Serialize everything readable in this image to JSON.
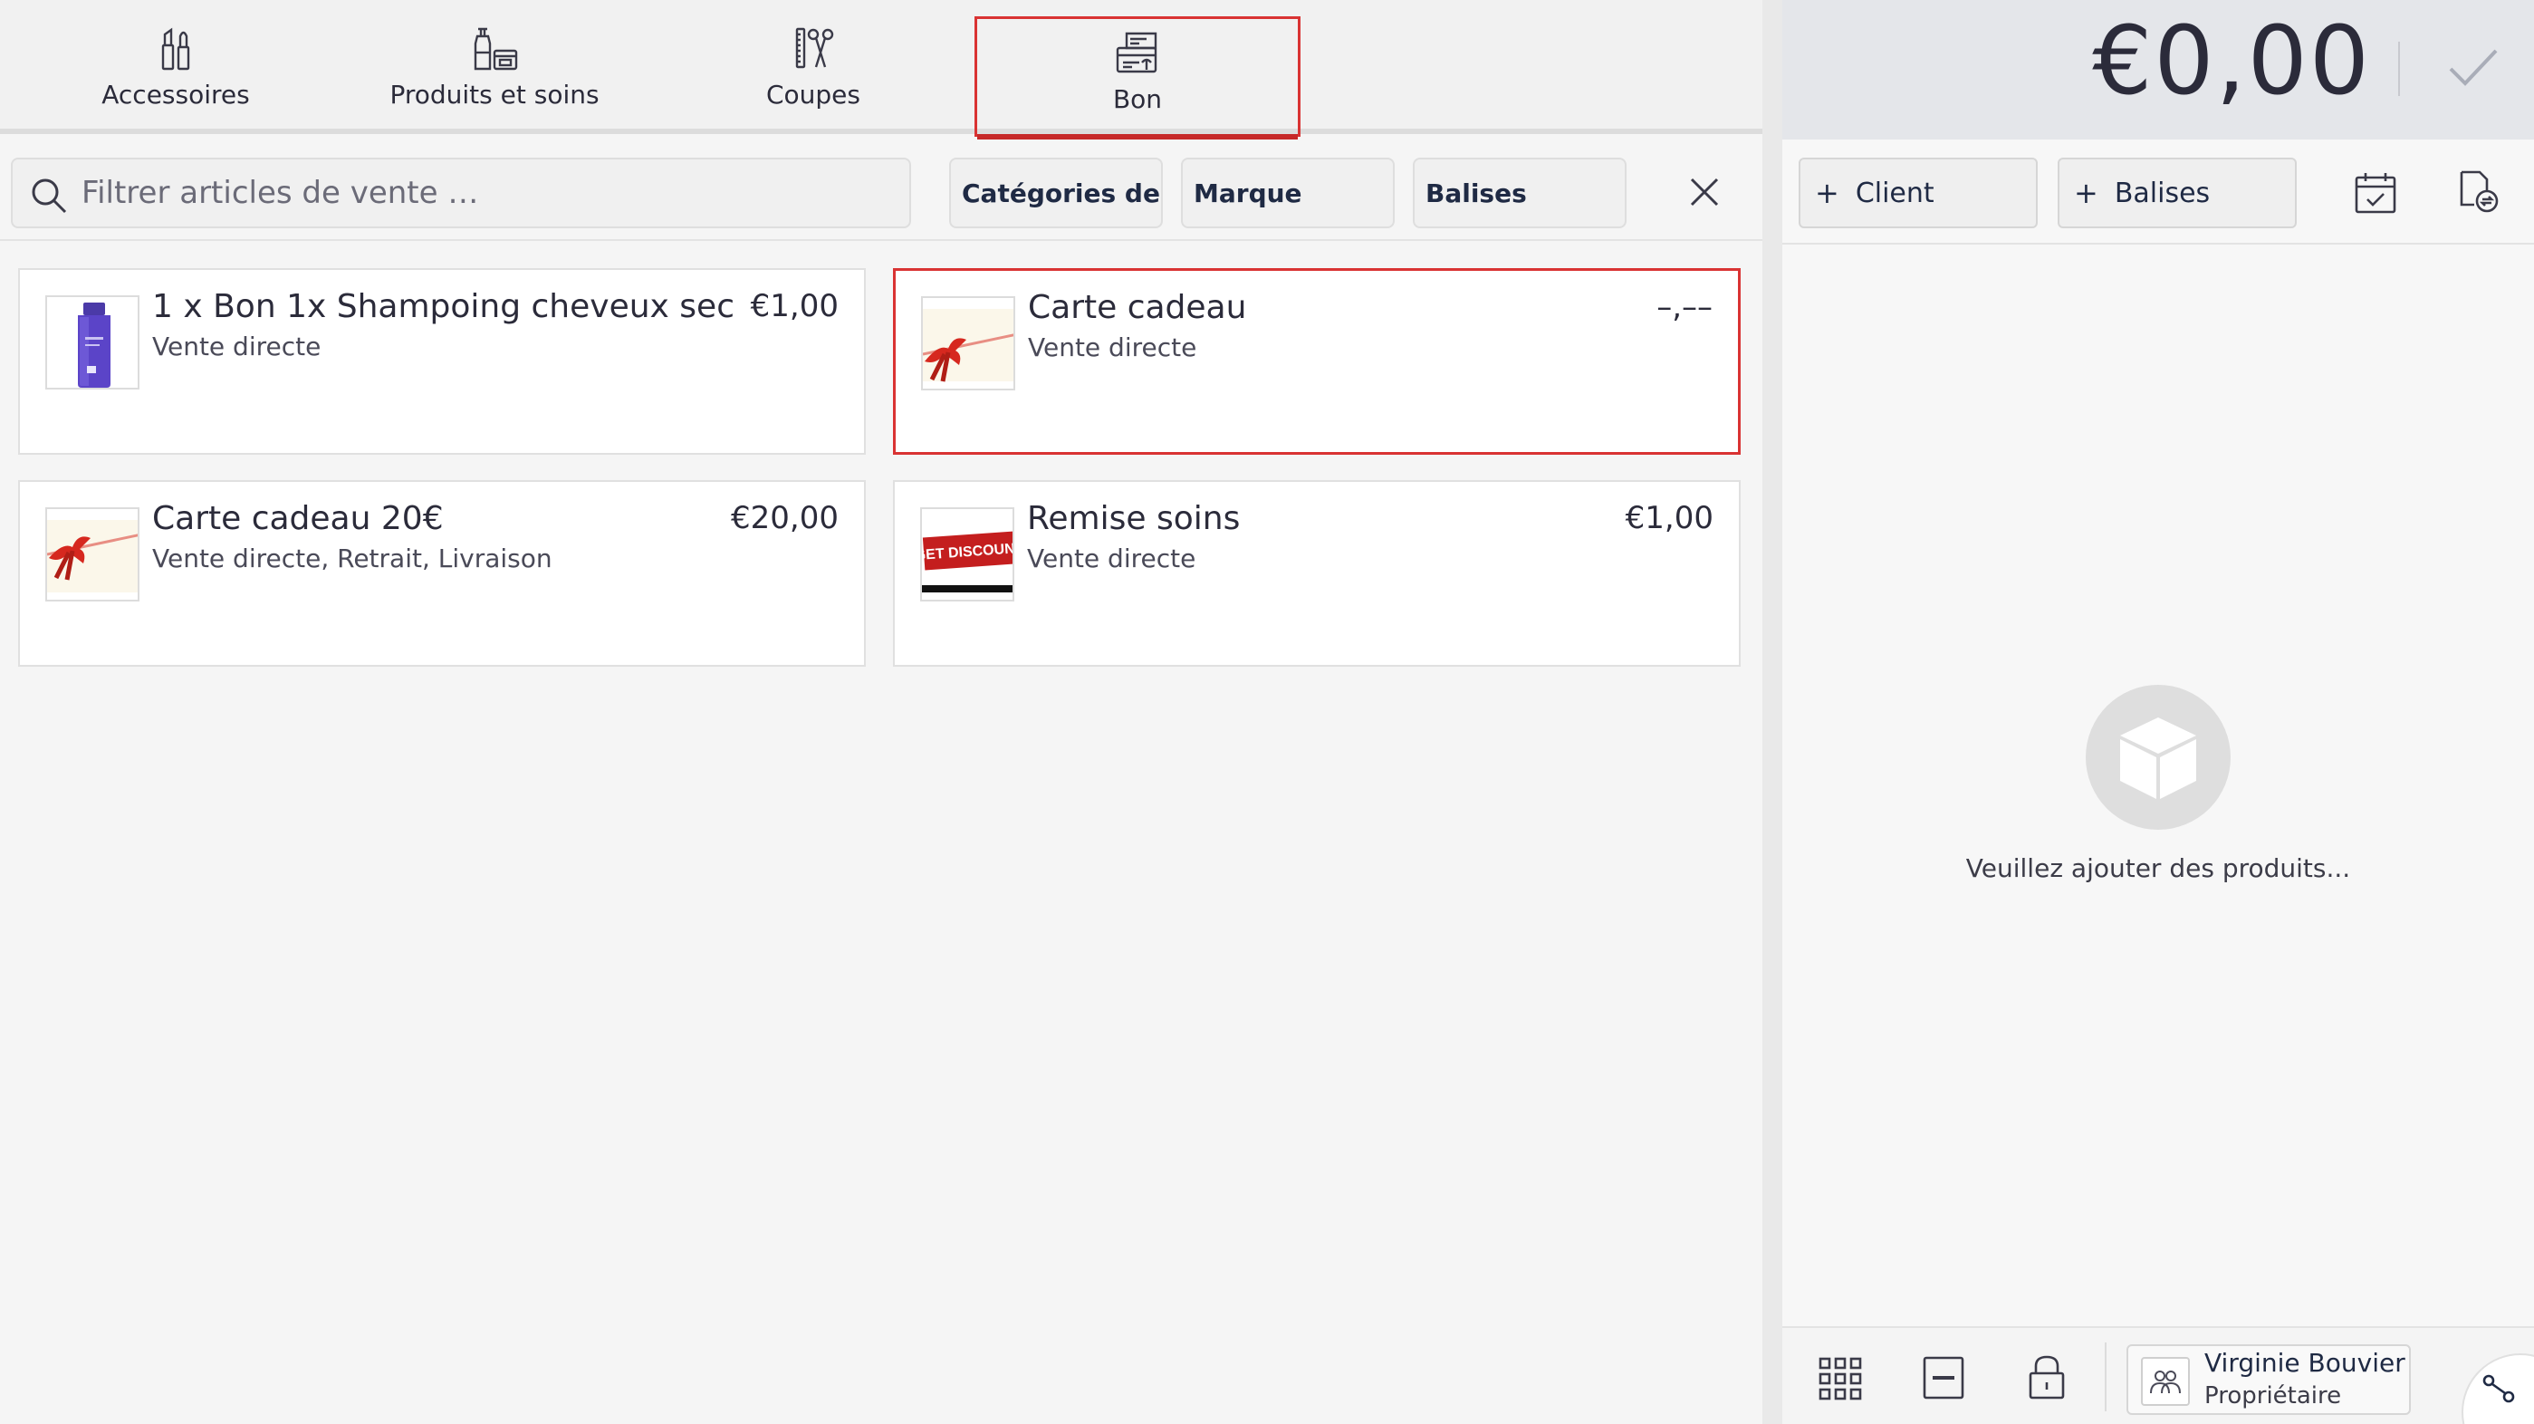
{
  "tabs": [
    {
      "label": "Accessoires",
      "icon": "lipstick-icon"
    },
    {
      "label": "Produits et soins",
      "icon": "products-bottles-icon"
    },
    {
      "label": "Coupes",
      "icon": "scissors-comb-icon"
    },
    {
      "label": "Bon",
      "icon": "voucher-icon",
      "active": true
    }
  ],
  "search": {
    "placeholder": "Filtrer articles de vente …",
    "filters": [
      "Catégories de...",
      "Marque",
      "Balises"
    ]
  },
  "products": [
    {
      "name": "1 x Bon 1x Shampoing cheveux sec",
      "subtitle": "Vente directe",
      "price": "€1,00",
      "thumb": "shampoo-bottle-image"
    },
    {
      "name": "Carte cadeau",
      "subtitle": "Vente directe",
      "price": "–,––",
      "thumb": "gift-card-bow-image",
      "selected": true
    },
    {
      "name": "Carte cadeau 20€",
      "subtitle": "Vente directe, Retrait, Livraison",
      "price": "€20,00",
      "thumb": "gift-card-bow-image"
    },
    {
      "name": "Remise soins",
      "subtitle": "Vente directe",
      "price": "€1,00",
      "thumb": "get-discount-image",
      "thumb_text": "GET DISCOUNT"
    }
  ],
  "cart": {
    "total": "€0,00",
    "client_label": "Client",
    "tags_label": "Balises",
    "empty_message": "Veuillez ajouter des produits..."
  },
  "user": {
    "name": "Virginie Bouvier",
    "role": "Propriétaire"
  },
  "colors": {
    "accent": "#1f2a44",
    "highlight": "#d93333",
    "total_bar": "#e4e6ea"
  }
}
